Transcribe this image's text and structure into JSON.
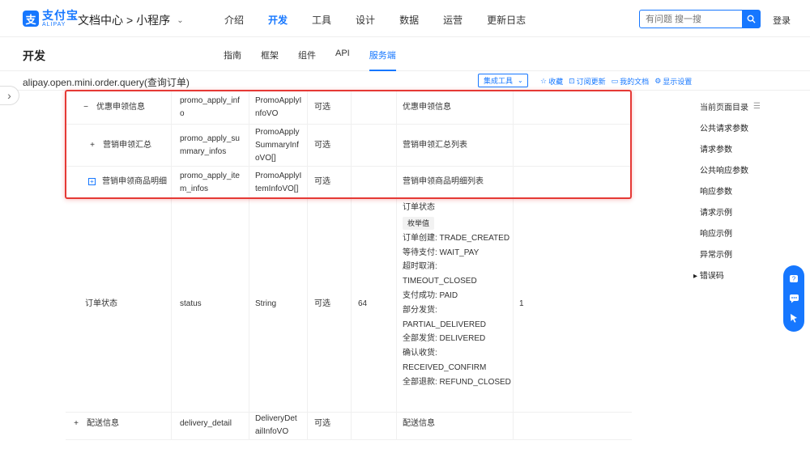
{
  "brand": {
    "cn": "支付宝",
    "en": "ALIPAY",
    "mark": "支"
  },
  "header": {
    "docs_title": "文档中心",
    "breadcrumb_sep": ">",
    "product": "小程序",
    "nav": [
      "介绍",
      "开发",
      "工具",
      "设计",
      "数据",
      "运营",
      "更新日志"
    ],
    "active_nav": 1,
    "search_placeholder": "有问题 搜一搜",
    "login": "登录"
  },
  "subheader": {
    "title": "开发",
    "tabs": [
      "指南",
      "框架",
      "组件",
      "API",
      "服务端"
    ],
    "active_tab": 4
  },
  "apibar": {
    "api_name": "alipay.open.mini.order.query(查询订单)",
    "tools_label": "集成工具",
    "actions": [
      "收藏",
      "订阅更新",
      "我的文档",
      "显示设置"
    ]
  },
  "table": {
    "rows": [
      {
        "expand": "−",
        "name": "优惠申领信息",
        "field": [
          "promo_apply_inf",
          "o"
        ],
        "type": [
          "PromoApplyI",
          "nfoVO"
        ],
        "required": "可选",
        "max": "",
        "desc": [
          "优惠申领信息"
        ],
        "example": ""
      },
      {
        "expand": "+",
        "name": "营销申领汇总",
        "field": [
          "promo_apply_su",
          "mmary_infos"
        ],
        "type": [
          "PromoApply",
          "SummaryInf",
          "oVO[]"
        ],
        "required": "可选",
        "max": "",
        "desc": [
          "营销申领汇总列表"
        ],
        "example": ""
      },
      {
        "expand": "box+",
        "name": "营销申领商品明细",
        "field": [
          "promo_apply_ite",
          "m_infos"
        ],
        "type": [
          "PromoApplyI",
          "temInfoVO[]"
        ],
        "required": "可选",
        "max": "",
        "desc": [
          "营销申领商品明细列表"
        ],
        "example": ""
      },
      {
        "expand": "",
        "name": "订单状态",
        "field": [
          "status"
        ],
        "type": [
          "String"
        ],
        "required": "可选",
        "max": "64",
        "desc_title": "订单状态",
        "enum_tag": "枚举值",
        "enum_lines": [
          "订单创建: TRADE_CREATED",
          "等待支付: WAIT_PAY",
          "超时取消:",
          "TIMEOUT_CLOSED",
          "支付成功: PAID",
          "部分发货:",
          "PARTIAL_DELIVERED",
          "全部发货: DELIVERED",
          "确认收货:",
          "RECEIVED_CONFIRM",
          "全部退款: REFUND_CLOSED"
        ],
        "example": "1"
      },
      {
        "expand": "+",
        "name": "配送信息",
        "field": [
          "delivery_detail"
        ],
        "type": [
          "DeliveryDet",
          "ailInfoVO"
        ],
        "required": "可选",
        "max": "",
        "desc": [
          "配送信息"
        ],
        "example": ""
      }
    ]
  },
  "toc": {
    "title": "当前页面目录",
    "items": [
      "公共请求参数",
      "请求参数",
      "公共响应参数",
      "响应参数",
      "请求示例",
      "响应示例",
      "异常示例",
      "错误码"
    ]
  },
  "colors": {
    "accent": "#1677ff",
    "highlight": "#e53935"
  }
}
